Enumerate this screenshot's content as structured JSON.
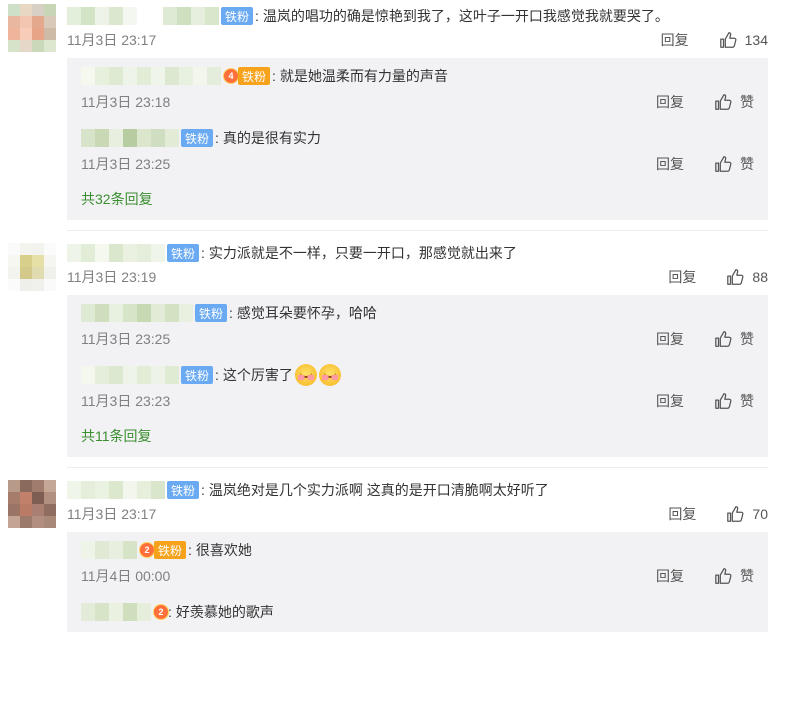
{
  "labels": {
    "reply": "回复",
    "like": "赞"
  },
  "comments": [
    {
      "badge": "铁粉",
      "text": "温岚的唱功的确是惊艳到我了，这叶子一开口我感觉我就要哭了。",
      "time": "11月3日 23:17",
      "likes": "134",
      "replies": [
        {
          "badge": "铁粉",
          "crown": "4",
          "text": "就是她温柔而有力量的声音",
          "time": "11月3日 23:18"
        },
        {
          "badge": "铁粉",
          "text": "真的是很有实力",
          "time": "11月3日 23:25"
        }
      ],
      "more": "共32条回复"
    },
    {
      "badge": "铁粉",
      "text": "实力派就是不一样，只要一开口，那感觉就出来了",
      "time": "11月3日 23:19",
      "likes": "88",
      "replies": [
        {
          "badge": "铁粉",
          "text": "感觉耳朵要怀孕，哈哈",
          "time": "11月3日 23:25"
        },
        {
          "badge": "铁粉",
          "text": "这个厉害了",
          "emoji_count": 2,
          "time": "11月3日 23:23"
        }
      ],
      "more": "共11条回复"
    },
    {
      "badge": "铁粉",
      "text": "温岚绝对是几个实力派啊 这真的是开口清脆啊太好听了",
      "time": "11月3日 23:17",
      "likes": "70",
      "replies": [
        {
          "badge": "铁粉",
          "crown": "2",
          "text": "很喜欢她",
          "time": "11月4日 00:00"
        },
        {
          "crown": "2",
          "text": "好羡慕她的歌声"
        }
      ]
    }
  ],
  "icons": {
    "like": "thumbs-up-icon",
    "emoji": "smiling-face-emoji"
  },
  "colors": {
    "badge_blue": "#6aaaf2",
    "badge_gold": "#f7a21b",
    "more_green": "#3a8e2f",
    "reply_bg": "#f2f2f5"
  }
}
